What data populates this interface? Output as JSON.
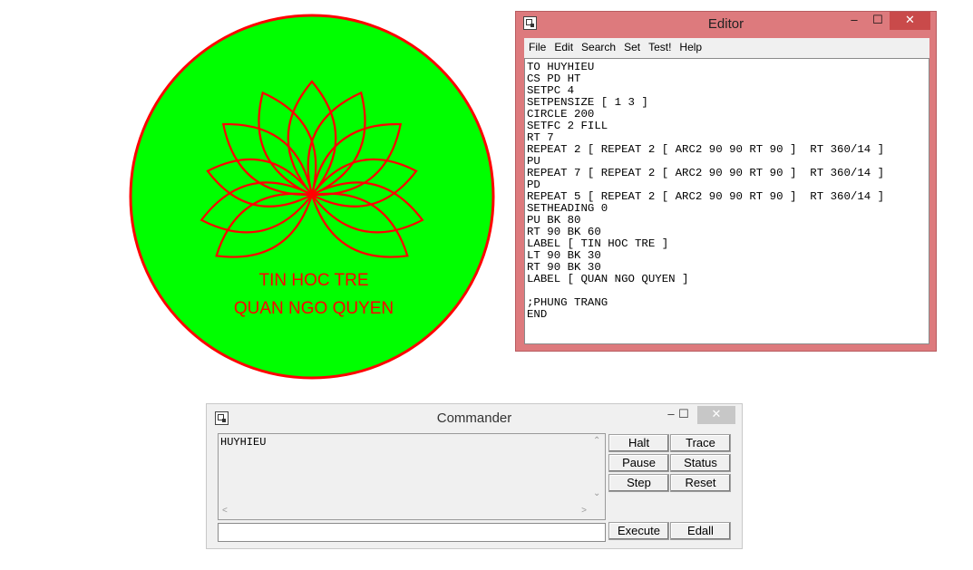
{
  "canvas": {
    "fill_color": "#00ff00",
    "pen_color": "#ff0000",
    "label_line1": "TIN HOC TRE",
    "label_line2": "QUAN NGO QUYEN"
  },
  "editor": {
    "title": "Editor",
    "window_buttons": [
      "–",
      "☐",
      "✕"
    ],
    "menu": [
      "File",
      "Edit",
      "Search",
      "Set",
      "Test!",
      "Help"
    ],
    "code": "TO HUYHIEU\nCS PD HT\nSETPC 4\nSETPENSIZE [ 1 3 ]\nCIRCLE 200\nSETFC 2 FILL\nRT 7\nREPEAT 2 [ REPEAT 2 [ ARC2 90 90 RT 90 ]  RT 360/14 ]\nPU\nREPEAT 7 [ REPEAT 2 [ ARC2 90 90 RT 90 ]  RT 360/14 ]\nPD\nREPEAT 5 [ REPEAT 2 [ ARC2 90 90 RT 90 ]  RT 360/14 ]\nSETHEADING 0\nPU BK 80\nRT 90 BK 60\nLABEL [ TIN HOC TRE ]\nLT 90 BK 30\nRT 90 BK 30\nLABEL [ QUAN NGO QUYEN ]\n\n;PHUNG TRANG\nEND",
    "title_bar_color": "#dd7a7d",
    "close_button_color": "#c94a4a"
  },
  "commander": {
    "title": "Commander",
    "window_buttons": [
      "–",
      "☐",
      "✕"
    ],
    "output_text": "HUYHIEU",
    "input_value": "",
    "buttons": {
      "halt": "Halt",
      "trace": "Trace",
      "pause": "Pause",
      "status": "Status",
      "step": "Step",
      "reset": "Reset",
      "execute": "Execute",
      "edall": "Edall"
    }
  }
}
